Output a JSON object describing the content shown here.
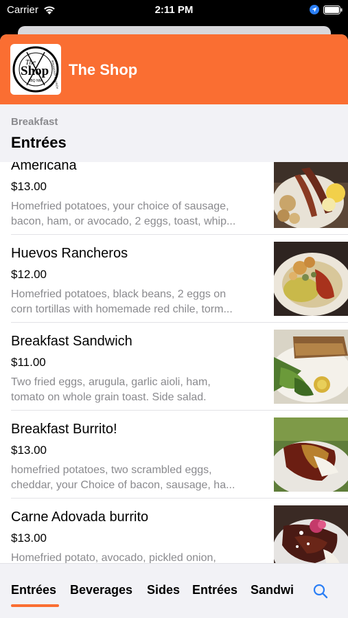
{
  "status_bar": {
    "carrier": "Carrier",
    "time": "2:11 PM"
  },
  "header": {
    "shop_name": "The Shop",
    "logo": {
      "line1": "The",
      "line2": "Shop",
      "line3": "ABQ NM",
      "ring_text": "BREAKFAST & LUNCH"
    }
  },
  "section": {
    "category": "Breakfast",
    "title": "Entrées"
  },
  "items": [
    {
      "name": "Americana",
      "price": "$13.00",
      "desc_line1": "Homefried potatoes, your choice of sausage,",
      "desc_line2": "bacon, ham, or avocado, 2 eggs, toast, whip..."
    },
    {
      "name": "Huevos Rancheros",
      "price": "$12.00",
      "desc_line1": "Homefried potatoes, black beans, 2 eggs on",
      "desc_line2": "corn tortillas with homemade red chile, torm..."
    },
    {
      "name": "Breakfast Sandwich",
      "price": "$11.00",
      "desc_line1": "Two fried eggs, arugula, garlic aioli, ham,",
      "desc_line2": "tomato on whole grain toast. Side salad."
    },
    {
      "name": "Breakfast Burrito!",
      "price": "$13.00",
      "desc_line1": "homefried potatoes, two scrambled eggs,",
      "desc_line2": "cheddar, your Choice of bacon, sausage,  ha..."
    },
    {
      "name": "Carne Adovada burrito",
      "price": "$13.00",
      "desc_line1": "Homefried potato, avocado, pickled onion,",
      "desc_line2": ""
    }
  ],
  "tabs": [
    "Entrées",
    "Beverages",
    "Sides",
    "Entrées",
    "Sandwi"
  ],
  "colors": {
    "accent": "#fa6e32",
    "secondary_text": "#8a8a8e",
    "tab_search": "#2a7ef5"
  },
  "icons": {
    "search": "search-icon",
    "wifi": "wifi-icon",
    "location": "location-arrow-icon",
    "battery": "battery-icon"
  }
}
